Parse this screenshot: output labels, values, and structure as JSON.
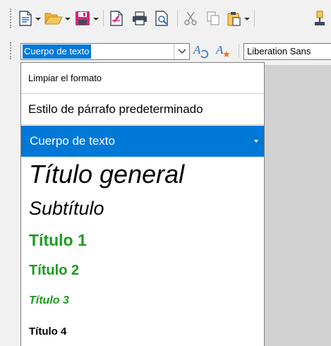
{
  "style_box": {
    "current_value": "Cuerpo de texto"
  },
  "font_box": {
    "current_value": "Liberation Sans"
  },
  "style_list": {
    "items": [
      {
        "label": "Limpiar el formato"
      },
      {
        "label": "Estilo de párrafo predeterminado"
      },
      {
        "label": "Cuerpo de texto",
        "selected": true
      },
      {
        "label": "Título general"
      },
      {
        "label": "Subtítulo"
      },
      {
        "label": "Título 1"
      },
      {
        "label": "Título 2"
      },
      {
        "label": "Título 3"
      },
      {
        "label": "Título 4"
      }
    ]
  },
  "colors": {
    "accent": "#0078d7",
    "heading_green": "#1c9b1c",
    "update_style_icon": "#2a6fbd",
    "new_style_icon": "#e8762d"
  },
  "toolbar_icons": [
    "new-document-icon",
    "open-folder-icon",
    "save-icon",
    "export-pdf-icon",
    "print-icon",
    "print-preview-icon",
    "cut-icon",
    "copy-icon",
    "paste-icon",
    "clone-formatting-icon",
    "update-style-icon",
    "new-style-icon"
  ]
}
